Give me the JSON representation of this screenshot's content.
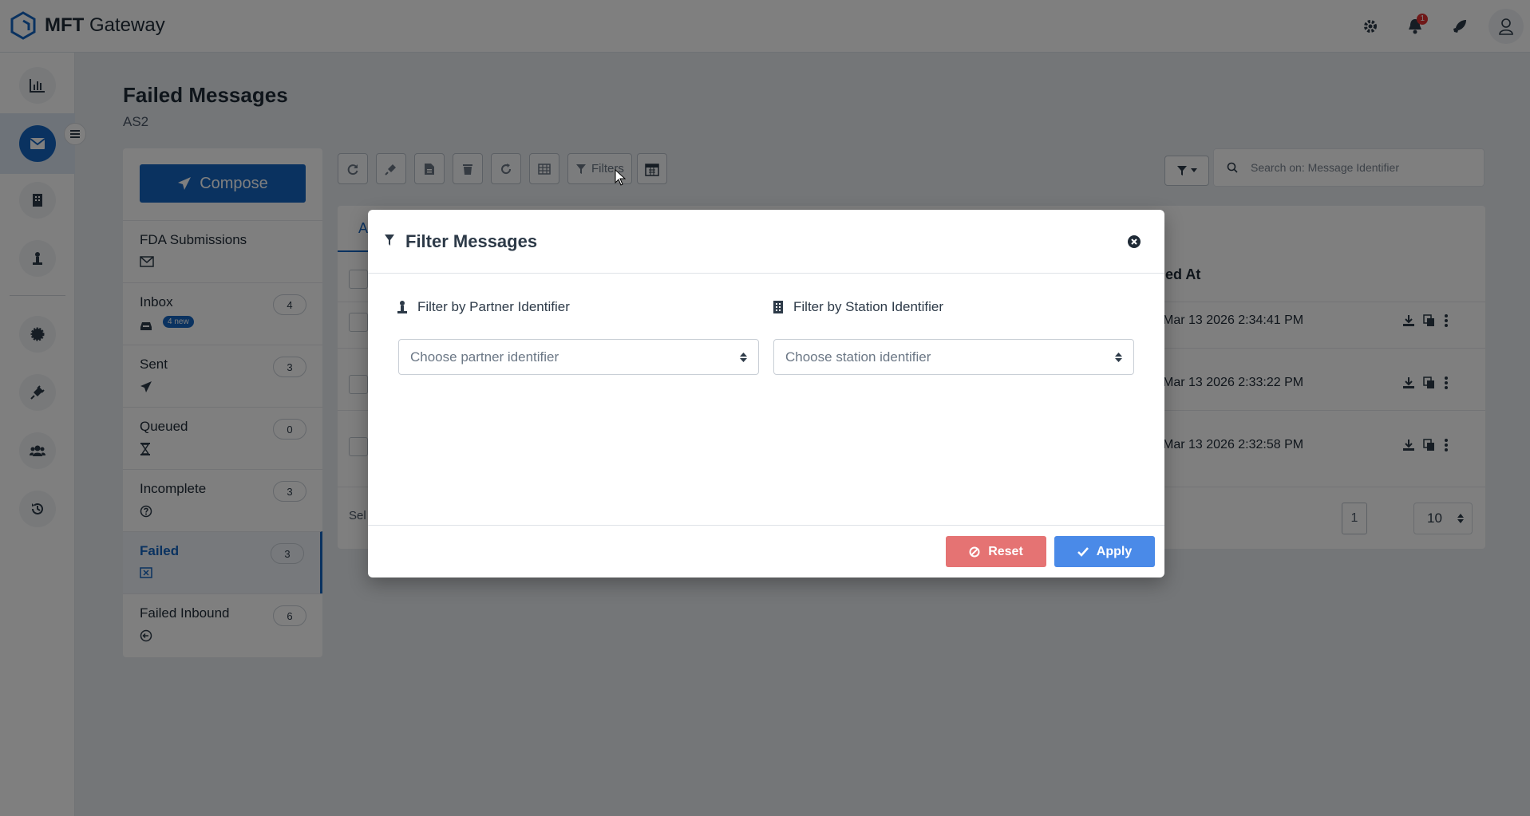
{
  "app": {
    "brand_bold": "MFT",
    "brand_rest": " Gateway",
    "notification_count": "1"
  },
  "page": {
    "title": "Failed Messages",
    "subtitle": "AS2"
  },
  "compose_label": "Compose",
  "folders": [
    {
      "name": "FDA Submissions",
      "icon": "envelope-icon",
      "count": null
    },
    {
      "name": "Inbox",
      "icon": "inbox-icon",
      "count": "4",
      "new_badge": "4 new"
    },
    {
      "name": "Sent",
      "icon": "paper-plane-icon",
      "count": "3"
    },
    {
      "name": "Queued",
      "icon": "hourglass-icon",
      "count": "0"
    },
    {
      "name": "Incomplete",
      "icon": "question-circle-icon",
      "count": "3"
    },
    {
      "name": "Failed",
      "icon": "failed-box-icon",
      "count": "3",
      "active": true
    },
    {
      "name": "Failed Inbound",
      "icon": "arrow-circle-icon",
      "count": "6"
    }
  ],
  "toolbar": {
    "filters_label": "Filters"
  },
  "search": {
    "placeholder": "Search on: Message Identifier"
  },
  "table": {
    "tab_partial": "A",
    "column_partial": "led At",
    "rows": [
      {
        "date": "Mar 13 2026 2:34:41 PM"
      },
      {
        "date": "Mar 13 2026 2:33:22 PM"
      },
      {
        "date": "Mar 13 2026 2:32:58 PM"
      }
    ],
    "footer_partial": "Sel",
    "page": "1",
    "per_page": "10"
  },
  "modal": {
    "title": "Filter Messages",
    "partner_label": "Filter by Partner Identifier",
    "partner_placeholder": "Choose partner identifier",
    "station_label": "Filter by Station Identifier",
    "station_placeholder": "Choose station identifier",
    "reset_label": "Reset",
    "apply_label": "Apply"
  },
  "colors": {
    "primary": "#1565c0",
    "reset": "#e57373",
    "apply": "#4a8ae8"
  }
}
